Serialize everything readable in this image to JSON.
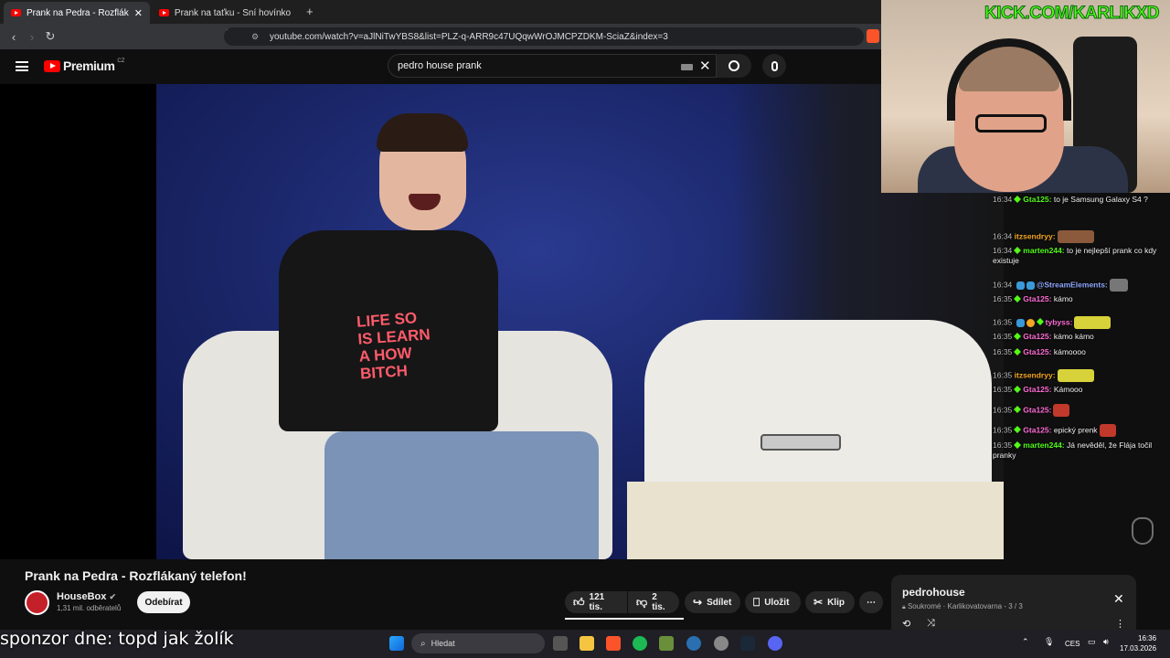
{
  "browser": {
    "tabs": [
      {
        "label": "Prank na Pedra - Rozflákaný tele",
        "active": true
      },
      {
        "label": "Prank na taťku - Sní hovínko!! - YouT",
        "active": false
      }
    ],
    "new_tab": "+",
    "url": "youtube.com/watch?v=aJlNiTwYBS8&list=PLZ-q-ARR9c47UQqwWrOJMCPZDKM-SciaZ&index=3"
  },
  "youtube": {
    "logo": "Premium",
    "logo_country": "CZ",
    "search_query": "pedro house prank",
    "video_shirt_text": "LIFE SO\nIS LEARN\nA HOW\nBITCH"
  },
  "overlay": {
    "kick_label": "KICK.COM/KARLIKXD",
    "chat": [
      {
        "time": "16:34",
        "user": "Gta125:",
        "user_color": "#53fc18",
        "text": "to je Samsung Galaxy S4 ?"
      },
      {
        "time": "16:34",
        "user": "itzsendryy:",
        "user_color": "#f5a623",
        "text": ""
      },
      {
        "time": "16:34",
        "user": "marten244:",
        "user_color": "#53fc18",
        "text": "to je nejlepší prank co kdy existuje"
      },
      {
        "time": "16:34",
        "user": "@StreamElements:",
        "user_color": "#8fa8ff",
        "text": ""
      },
      {
        "time": "16:35",
        "user": "Gta125:",
        "user_color": "#ff6bd6",
        "text": "kámo"
      },
      {
        "time": "16:35",
        "user": "tybyss:",
        "user_color": "#ff6bd6",
        "text": ""
      },
      {
        "time": "16:35",
        "user": "Gta125:",
        "user_color": "#ff6bd6",
        "text": "kámo kámo"
      },
      {
        "time": "16:35",
        "user": "Gta125:",
        "user_color": "#ff6bd6",
        "text": "kámoooo"
      },
      {
        "time": "16:35",
        "user": "itzsendryy:",
        "user_color": "#f5a623",
        "text": ""
      },
      {
        "time": "16:35",
        "user": "Gta125:",
        "user_color": "#ff6bd6",
        "text": "Kámooo"
      },
      {
        "time": "16:35",
        "user": "Gta125:",
        "user_color": "#ff6bd6",
        "text": ""
      },
      {
        "time": "16:35",
        "user": "Gta125:",
        "user_color": "#ff6bd6",
        "text": "epický prenk"
      },
      {
        "time": "16:35",
        "user": "marten244:",
        "user_color": "#53fc18",
        "text": "Já nevěděl, že Flája točil pranky"
      }
    ]
  },
  "video_info": {
    "title": "Prank na Pedra - Rozflákaný telefon!",
    "channel": "HouseBox",
    "subscribers": "1,31 mil. odběratelů",
    "subscribe_label": "Odebírat",
    "likes": "121 tis.",
    "dislikes": "2 tis.",
    "share_label": "Sdílet",
    "save_label": "Uložit",
    "clip_label": "Klip",
    "more": "⋯"
  },
  "playlist": {
    "title": "pedrohouse",
    "subtitle": "Soukromé · Karlikovatovarna - 3 / 3"
  },
  "sponsor_text": "sponzor dne: topd jak žolík",
  "taskbar": {
    "search_label": "Hledat",
    "lang": "CES",
    "time": "16:36",
    "date": "17.03.2026"
  },
  "colors": {
    "youtube_red": "#ff0000",
    "kick_green": "#53fc18",
    "background": "#0f0f0f"
  }
}
